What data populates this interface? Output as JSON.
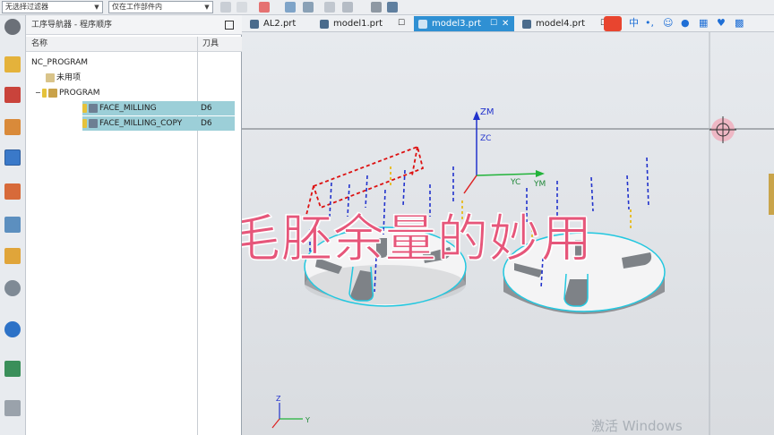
{
  "toolbar": {
    "filter_select": "无选择过滤器",
    "scope_select": "仅在工作部件内"
  },
  "navigator": {
    "title": "工序导航器 - 程序顺序",
    "col_name": "名称",
    "col_tool": "刀具",
    "root": "NC_PROGRAM",
    "unused": "未用项",
    "program": "PROGRAM",
    "rows": [
      {
        "name": "FACE_MILLING",
        "tool": "D6"
      },
      {
        "name": "FACE_MILLING_COPY",
        "tool": "D6"
      }
    ]
  },
  "tabs": [
    {
      "label": "AL2.prt",
      "modified": false
    },
    {
      "label": "model1.prt",
      "modified": true
    },
    {
      "label": "model3.prt",
      "modified": true,
      "active": true
    },
    {
      "label": "model4.prt",
      "modified": true
    }
  ],
  "axes": {
    "zm": "ZM",
    "zc": "ZC",
    "yc": "YC",
    "ym": "YM",
    "z": "Z",
    "y": "Y"
  },
  "overlay_title": "UG面铣毛胚余量的妙用",
  "watermark": "激活 Windows",
  "colors": {
    "accent": "#2f90d3",
    "selection": "#9ccfd8",
    "title_pink": "#e6567a",
    "toolpath_blue": "#2233cc",
    "toolpath_red": "#dd1111",
    "toolpath_cyan": "#22c8e0"
  }
}
